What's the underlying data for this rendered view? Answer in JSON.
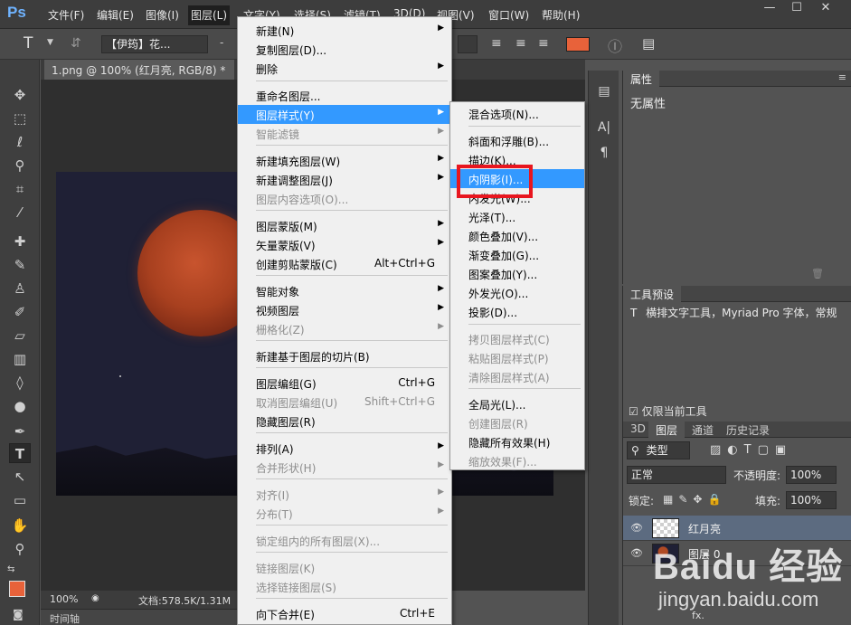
{
  "app": {
    "logo": "Ps",
    "menus": [
      "文件(F)",
      "编辑(E)",
      "图像(I)",
      "图层(L)",
      "文字(Y)",
      "选择(S)",
      "滤镜(T)",
      "3D(D)",
      "视图(V)",
      "窗口(W)",
      "帮助(H)"
    ],
    "window_buttons": [
      "—",
      "☐",
      "✕"
    ]
  },
  "options_bar": {
    "tool_glyph": "T",
    "font_family": "【伊筠】花...",
    "dash": "-",
    "color_hex": "#e8623a"
  },
  "document": {
    "tab_title": "1.png @ 100% (红月亮, RGB/8) *",
    "tab_close": "×",
    "zoom": "100%",
    "doc_size": "文档:578.5K/1.31M",
    "timeline": "时间轴"
  },
  "layer_menu": {
    "items": [
      {
        "label": "新建(N)",
        "submenu": true,
        "disabled": false
      },
      {
        "label": "复制图层(D)...",
        "disabled": false
      },
      {
        "label": "删除",
        "submenu": true,
        "disabled": false
      },
      {
        "label": "重命名图层...",
        "disabled": false
      },
      {
        "label": "图层样式(Y)",
        "submenu": true,
        "highlighted": true
      },
      {
        "label": "智能滤镜",
        "submenu": true,
        "disabled": true
      },
      {
        "label": "新建填充图层(W)",
        "submenu": true
      },
      {
        "label": "新建调整图层(J)",
        "submenu": true
      },
      {
        "label": "图层内容选项(O)...",
        "disabled": true
      },
      {
        "label": "图层蒙版(M)",
        "submenu": true
      },
      {
        "label": "矢量蒙版(V)",
        "submenu": true
      },
      {
        "label": "创建剪贴蒙版(C)",
        "shortcut": "Alt+Ctrl+G"
      },
      {
        "label": "智能对象",
        "submenu": true
      },
      {
        "label": "视频图层",
        "submenu": true
      },
      {
        "label": "栅格化(Z)",
        "submenu": true,
        "disabled": true
      },
      {
        "label": "新建基于图层的切片(B)"
      },
      {
        "label": "图层编组(G)",
        "shortcut": "Ctrl+G"
      },
      {
        "label": "取消图层编组(U)",
        "shortcut": "Shift+Ctrl+G",
        "disabled": true
      },
      {
        "label": "隐藏图层(R)"
      },
      {
        "label": "排列(A)",
        "submenu": true
      },
      {
        "label": "合并形状(H)",
        "submenu": true,
        "disabled": true
      },
      {
        "label": "对齐(I)",
        "submenu": true,
        "disabled": true
      },
      {
        "label": "分布(T)",
        "submenu": true,
        "disabled": true
      },
      {
        "label": "锁定组内的所有图层(X)...",
        "disabled": true
      },
      {
        "label": "链接图层(K)",
        "disabled": true
      },
      {
        "label": "选择链接图层(S)",
        "disabled": true
      },
      {
        "label": "向下合并(E)",
        "shortcut": "Ctrl+E"
      }
    ]
  },
  "style_submenu": {
    "items": [
      {
        "label": "混合选项(N)..."
      },
      {
        "label": "斜面和浮雕(B)..."
      },
      {
        "label": "描边(K)..."
      },
      {
        "label": "内阴影(I)...",
        "highlighted": true
      },
      {
        "label": "内发光(W)..."
      },
      {
        "label": "光泽(T)..."
      },
      {
        "label": "颜色叠加(V)..."
      },
      {
        "label": "渐变叠加(G)..."
      },
      {
        "label": "图案叠加(Y)..."
      },
      {
        "label": "外发光(O)..."
      },
      {
        "label": "投影(D)..."
      },
      {
        "label": "拷贝图层样式(C)",
        "disabled": true
      },
      {
        "label": "粘贴图层样式(P)",
        "disabled": true
      },
      {
        "label": "清除图层样式(A)",
        "disabled": true
      },
      {
        "label": "全局光(L)..."
      },
      {
        "label": "创建图层(R)",
        "disabled": true
      },
      {
        "label": "隐藏所有效果(H)"
      },
      {
        "label": "缩放效果(F)...",
        "disabled": true
      }
    ]
  },
  "properties_panel": {
    "tab": "属性",
    "body": "无属性"
  },
  "presets_panel": {
    "tab": "工具预设",
    "row": "横排文字工具，Myriad Pro 字体，常规",
    "row_glyph": "T",
    "checkbox": "仅限当前工具"
  },
  "layers_panel": {
    "tabs": [
      "3D",
      "图层",
      "通道",
      "历史记录"
    ],
    "filter": "类型",
    "blend_mode": "正常",
    "opacity_label": "不透明度:",
    "opacity": "100%",
    "lock_label": "锁定:",
    "fill_label": "填充:",
    "fill": "100%",
    "layers": [
      {
        "name": "红月亮",
        "selected": true
      },
      {
        "name": "图层 0",
        "selected": false
      }
    ],
    "footer": "fx."
  },
  "watermark": {
    "logo": "Baidu 经验",
    "url": "jingyan.baidu.com"
  }
}
